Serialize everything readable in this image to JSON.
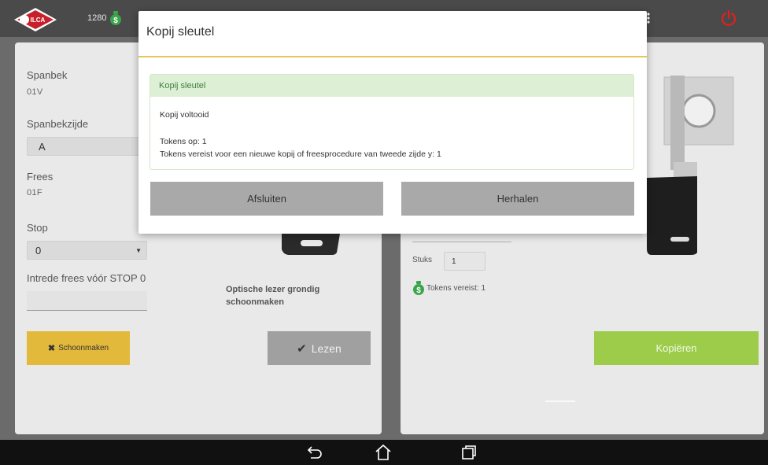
{
  "topbar": {
    "token_count": "1280",
    "colors": {
      "power": "#e02020",
      "coin": "#3aa64b"
    }
  },
  "left_panel": {
    "spanbek_label": "Spanbek",
    "spanbek_value": "01V",
    "spanbekzijde_label": "Spanbekzijde",
    "spanbekzijde_value": "A",
    "frees_label": "Frees",
    "frees_value": "01F",
    "stop_label": "Stop",
    "stop_value": "0",
    "intrede_label": "Intrede frees vóór STOP 0",
    "intrede_value": "",
    "hint": [
      "Optische lezer grondig",
      "schoonmaken"
    ],
    "clean_button": "Schoonmaken",
    "read_button": "Lezen"
  },
  "right_panel": {
    "stuks_label": "Stuks",
    "stuks_value": "1",
    "tokens_required": "Tokens vereist: 1",
    "copy_button": "Kopiëren"
  },
  "modal": {
    "title": "Kopij sleutel",
    "message_header": "Kopij sleutel",
    "message_status": "Kopij voltooid",
    "tokens_left": "Tokens op: 1",
    "tokens_needed": "Tokens vereist voor een nieuwe kopij of freesprocedure van tweede zijde y: 1",
    "close_button": "Afsluiten",
    "repeat_button": "Herhalen"
  }
}
